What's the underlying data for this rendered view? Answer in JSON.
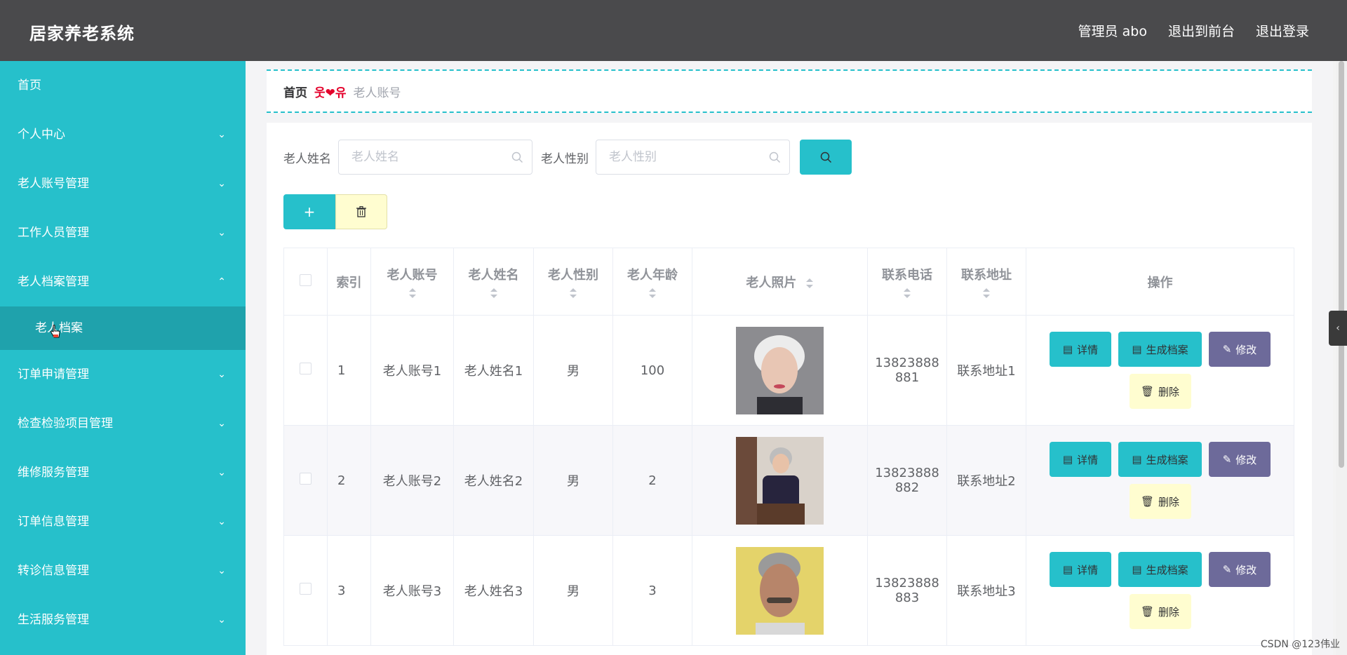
{
  "header": {
    "app_title": "居家养老系统",
    "admin_label": "管理员 abo",
    "to_front_label": "退出到前台",
    "logout_label": "退出登录"
  },
  "sidebar": {
    "home": "首页",
    "items": [
      {
        "label": "个人中心"
      },
      {
        "label": "老人账号管理"
      },
      {
        "label": "工作人员管理"
      },
      {
        "label": "老人档案管理",
        "expanded": true
      },
      {
        "label": "订单申请管理"
      },
      {
        "label": "检查检验项目管理"
      },
      {
        "label": "维修服务管理"
      },
      {
        "label": "订单信息管理"
      },
      {
        "label": "转诊信息管理"
      },
      {
        "label": "生活服务管理"
      }
    ],
    "active_sub": "老人档案"
  },
  "breadcrumb": {
    "home": "首页",
    "separator": "웃❤유",
    "current": "老人账号"
  },
  "search": {
    "name_label": "老人姓名",
    "name_placeholder": "老人姓名",
    "gender_label": "老人性别",
    "gender_placeholder": "老人性别"
  },
  "table": {
    "headers": {
      "index": "索引",
      "account": "老人账号",
      "name": "老人姓名",
      "gender": "老人性别",
      "age": "老人年龄",
      "photo": "老人照片",
      "phone": "联系电话",
      "address": "联系地址",
      "ops": "操作"
    },
    "rows": [
      {
        "index": "1",
        "account": "老人账号1",
        "name": "老人姓名1",
        "gender": "男",
        "age": "100",
        "phone_a": "13823888",
        "phone_b": "881",
        "address": "联系地址1"
      },
      {
        "index": "2",
        "account": "老人账号2",
        "name": "老人姓名2",
        "gender": "男",
        "age": "2",
        "phone_a": "13823888",
        "phone_b": "882",
        "address": "联系地址2"
      },
      {
        "index": "3",
        "account": "老人账号3",
        "name": "老人姓名3",
        "gender": "男",
        "age": "3",
        "phone_a": "13823888",
        "phone_b": "883",
        "address": "联系地址3"
      }
    ],
    "op_labels": {
      "detail": "详情",
      "generate": "生成档案",
      "edit": "修改",
      "delete": "删除"
    }
  },
  "watermark": "CSDN @123伟业",
  "colors": {
    "primary": "#26c0cb",
    "header": "#4a4a4c",
    "edit": "#6d6a9a",
    "delete": "#fffdd0",
    "breadcrumb_sep": "#e4002b"
  }
}
